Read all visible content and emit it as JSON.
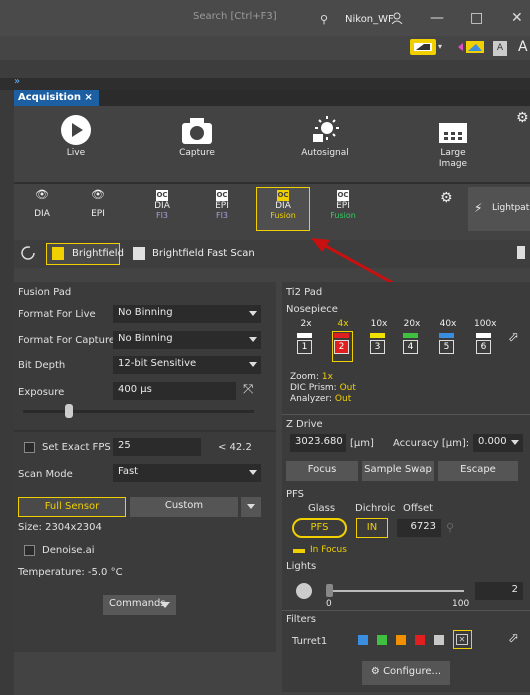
{
  "titlebar": {
    "search_placeholder": "Search [Ctrl+F3]",
    "user": "Nikon_WF",
    "minimize": "—",
    "restore": "□",
    "close": "✕"
  },
  "toolbar2": {
    "a_small": "A",
    "a_large": "A"
  },
  "tab": {
    "label": "Acquisition ×"
  },
  "big_tools": [
    {
      "label": "Live"
    },
    {
      "label": "Capture"
    },
    {
      "label": "Autosignal"
    },
    {
      "label": "Large\nImage"
    }
  ],
  "modes": [
    {
      "l1": "DIA",
      "l2": ""
    },
    {
      "l1": "EPI",
      "l2": ""
    },
    {
      "l1": "DIA",
      "l2": "FI3"
    },
    {
      "l1": "EPI",
      "l2": "FI3"
    },
    {
      "l1": "DIA",
      "l2": "Fusion"
    },
    {
      "l1": "EPI",
      "l2": "Fusion"
    }
  ],
  "mode_icon_text": "OC",
  "lightpath": "Lightpath",
  "subbar": {
    "brightfield": "Brightfield",
    "brightfield_fast": "Brightfield Fast Scan"
  },
  "fusion": {
    "title": "Fusion Pad",
    "format_live_label": "Format For Live",
    "format_live_value": "No Binning",
    "format_capture_label": "Format For Capture",
    "format_capture_value": "No Binning",
    "bit_depth_label": "Bit Depth",
    "bit_depth_value": "12-bit Sensitive",
    "exposure_label": "Exposure",
    "exposure_value": "400 µs",
    "exposure_slider_level": 0.18,
    "set_fps_label": "Set Exact FPS",
    "fps_value": "25",
    "fps_max": "< 42.2",
    "scan_mode_label": "Scan Mode",
    "scan_mode_value": "Fast",
    "full_sensor": "Full Sensor",
    "custom": "Custom",
    "size": "Size: 2304x2304",
    "denoise": "Denoise.ai",
    "temperature": "Temperature: -5.0 °C",
    "commands": "Commands"
  },
  "ti2": {
    "title": "Ti2 Pad",
    "nosepiece_label": "Nosepiece",
    "objectives": [
      {
        "mag": "2x",
        "pos": "1",
        "color": "#ffffff"
      },
      {
        "mag": "4x",
        "pos": "2",
        "color": "#e02020"
      },
      {
        "mag": "10x",
        "pos": "3",
        "color": "#f0e000"
      },
      {
        "mag": "20x",
        "pos": "4",
        "color": "#40c040"
      },
      {
        "mag": "40x",
        "pos": "5",
        "color": "#3a8ee0"
      },
      {
        "mag": "100x",
        "pos": "6",
        "color": "#ffffff"
      }
    ],
    "zoom_label": "Zoom:",
    "zoom_value": "1x",
    "dic_label": "DIC Prism:",
    "dic_value": "Out",
    "analyzer_label": "Analyzer:",
    "analyzer_value": "Out",
    "zdrive_label": "Z Drive",
    "z_value": "3023.680",
    "z_unit": "[µm]",
    "accuracy_label": "Accuracy [µm]:",
    "accuracy_value": "0.000",
    "focus": "Focus",
    "sample_swap": "Sample Swap",
    "escape": "Escape",
    "pfs_label": "PFS",
    "glass": "Glass",
    "dichroic": "Dichroic",
    "offset": "Offset",
    "pfs_btn": "PFS",
    "in_btn": "IN",
    "offset_value": "6723",
    "in_focus": "In Focus",
    "lights_label": "Lights",
    "light_min": "0",
    "light_max": "100",
    "light_value": "2",
    "filters_label": "Filters",
    "turret": "Turret1",
    "filter_colors": [
      "#3a8ee0",
      "#40c040",
      "#f09000",
      "#e02020",
      "#c8c8c8"
    ],
    "configure": "Configure..."
  }
}
